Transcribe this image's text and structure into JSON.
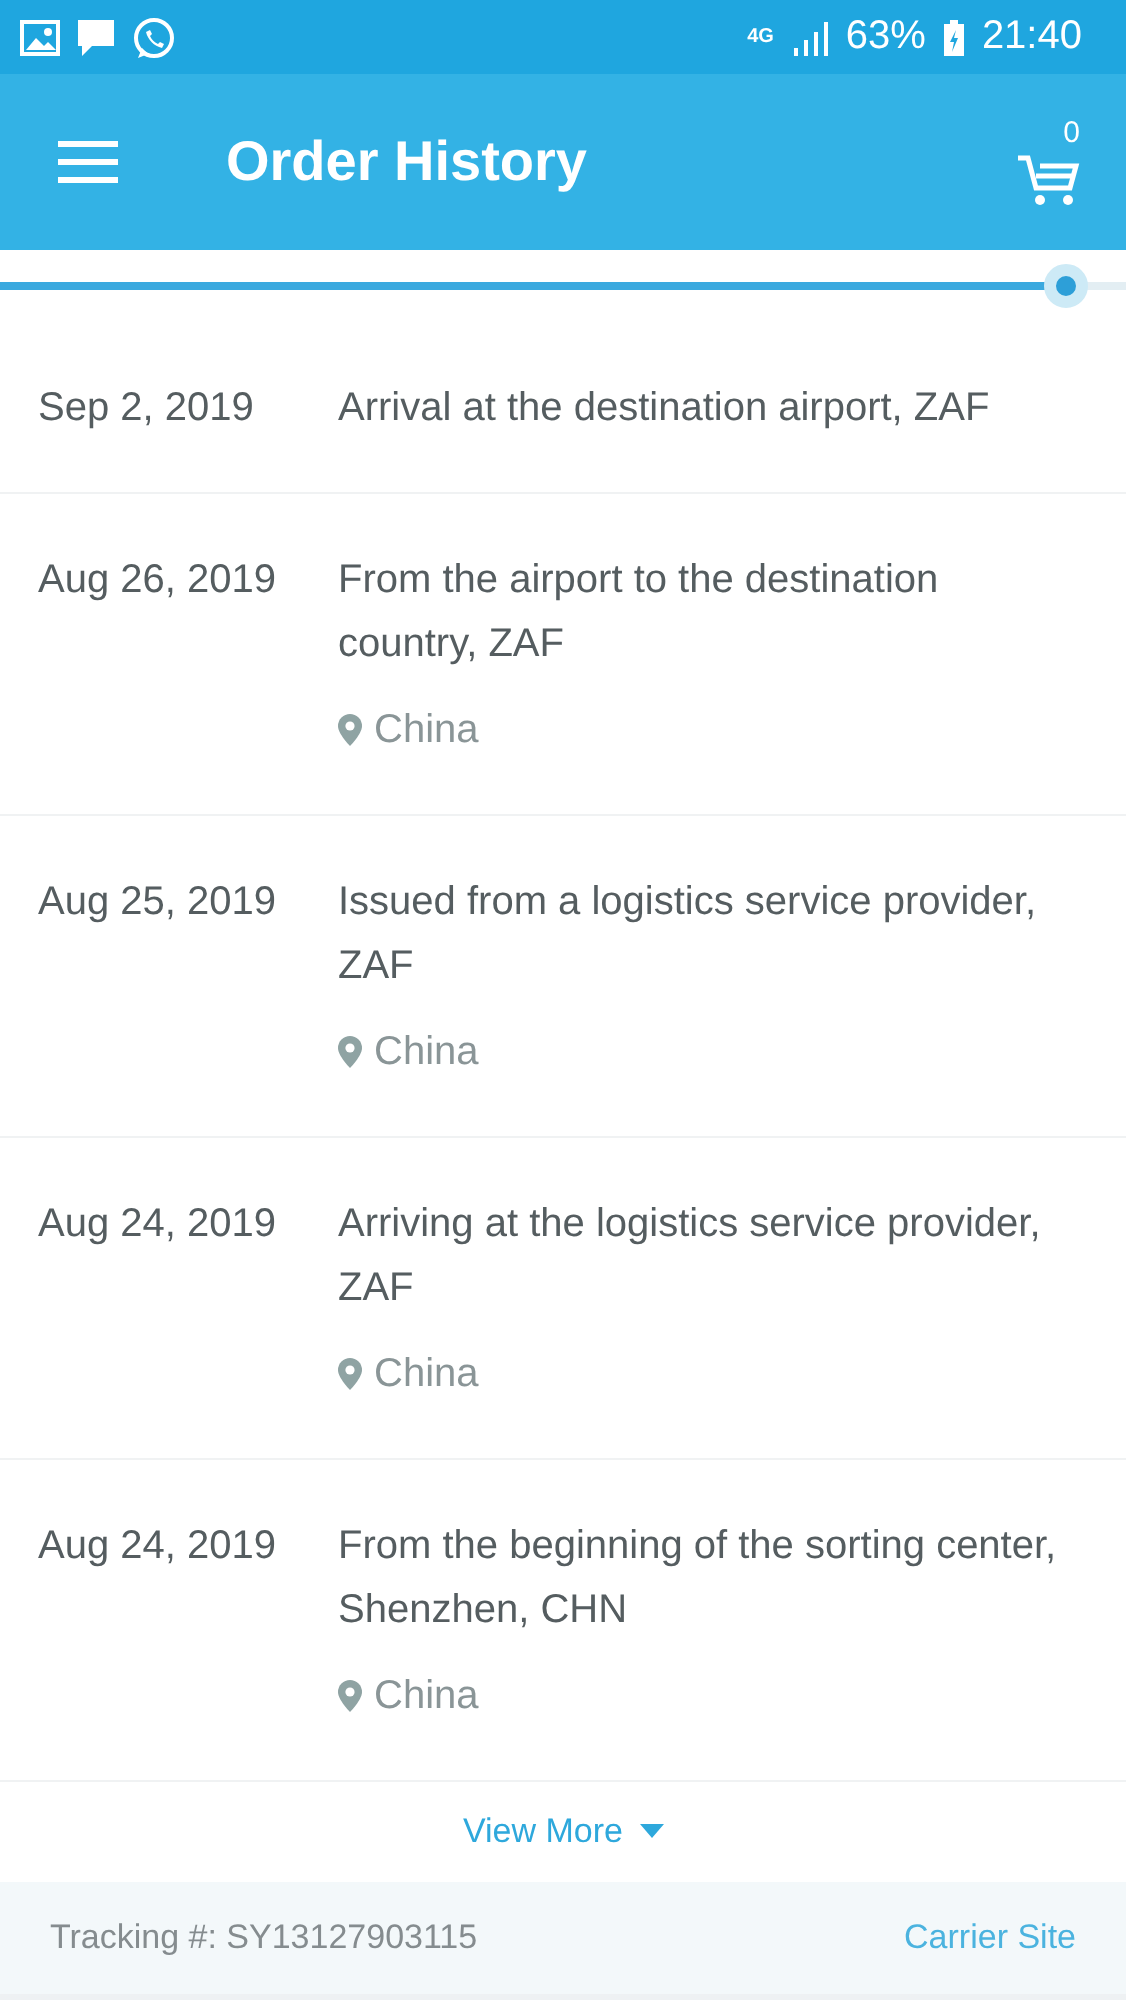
{
  "status_bar": {
    "network": "4G",
    "battery": "63%",
    "time": "21:40"
  },
  "app_bar": {
    "title": "Order History",
    "cart_count": "0"
  },
  "progress": {
    "level": 0.95
  },
  "events": [
    {
      "date": "Sep 2, 2019",
      "description": "Arrival at the destination airport, ZAF"
    },
    {
      "date": "Aug 26, 2019",
      "description": "From the airport to the destination country, ZAF",
      "location": "China"
    },
    {
      "date": "Aug 25, 2019",
      "description": "Issued from a logistics service provider, ZAF",
      "location": "China"
    },
    {
      "date": "Aug 24, 2019",
      "description": "Arriving at the logistics service provider, ZAF",
      "location": "China"
    },
    {
      "date": "Aug 24, 2019",
      "description": "From the beginning of the sorting center, Shenzhen, CHN",
      "location": "China"
    }
  ],
  "view_more": "View More",
  "footer": {
    "tracking": "Tracking #: SY13127903115",
    "carrier_link": "Carrier Site"
  }
}
